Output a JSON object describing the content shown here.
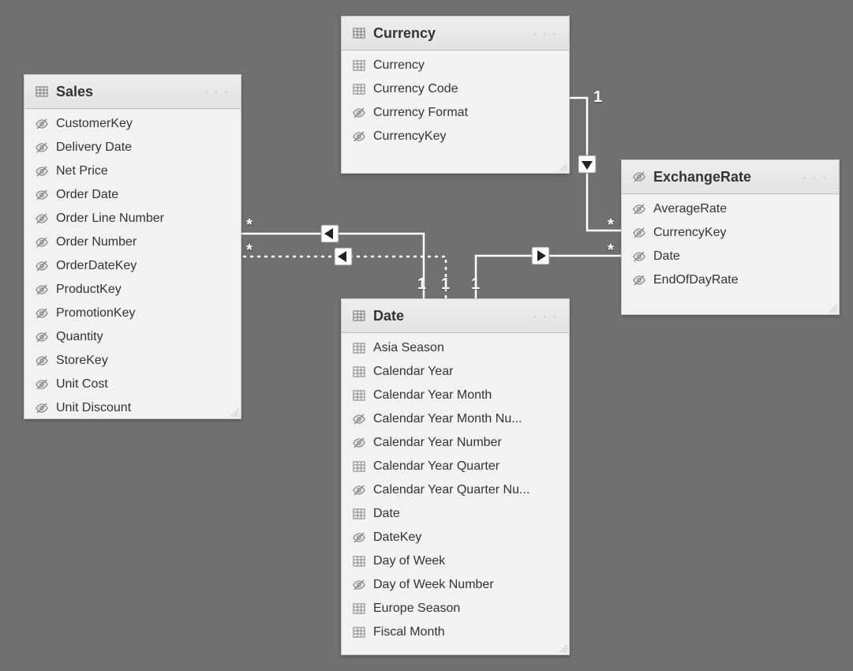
{
  "tables": {
    "sales": {
      "title": "Sales",
      "fields": [
        {
          "label": "CustomerKey",
          "hidden": true
        },
        {
          "label": "Delivery Date",
          "hidden": true
        },
        {
          "label": "Net Price",
          "hidden": true
        },
        {
          "label": "Order Date",
          "hidden": true
        },
        {
          "label": "Order Line Number",
          "hidden": true
        },
        {
          "label": "Order Number",
          "hidden": true
        },
        {
          "label": "OrderDateKey",
          "hidden": true
        },
        {
          "label": "ProductKey",
          "hidden": true
        },
        {
          "label": "PromotionKey",
          "hidden": true
        },
        {
          "label": "Quantity",
          "hidden": true
        },
        {
          "label": "StoreKey",
          "hidden": true
        },
        {
          "label": "Unit Cost",
          "hidden": true
        },
        {
          "label": "Unit Discount",
          "hidden": true
        }
      ]
    },
    "currency": {
      "title": "Currency",
      "fields": [
        {
          "label": "Currency",
          "hidden": false
        },
        {
          "label": "Currency Code",
          "hidden": false
        },
        {
          "label": "Currency Format",
          "hidden": true
        },
        {
          "label": "CurrencyKey",
          "hidden": true
        }
      ]
    },
    "date": {
      "title": "Date",
      "fields": [
        {
          "label": "Asia Season",
          "hidden": false
        },
        {
          "label": "Calendar Year",
          "hidden": false
        },
        {
          "label": "Calendar Year Month",
          "hidden": false
        },
        {
          "label": "Calendar Year Month Nu...",
          "hidden": true
        },
        {
          "label": "Calendar Year Number",
          "hidden": true
        },
        {
          "label": "Calendar Year Quarter",
          "hidden": false
        },
        {
          "label": "Calendar Year Quarter Nu...",
          "hidden": true
        },
        {
          "label": "Date",
          "hidden": false
        },
        {
          "label": "DateKey",
          "hidden": true
        },
        {
          "label": "Day of Week",
          "hidden": false
        },
        {
          "label": "Day of Week Number",
          "hidden": true
        },
        {
          "label": "Europe Season",
          "hidden": false
        },
        {
          "label": "Fiscal Month",
          "hidden": false
        }
      ]
    },
    "exchangerate": {
      "title": "ExchangeRate",
      "headerHidden": true,
      "fields": [
        {
          "label": "AverageRate",
          "hidden": true
        },
        {
          "label": "CurrencyKey",
          "hidden": true
        },
        {
          "label": "Date",
          "hidden": true
        },
        {
          "label": "EndOfDayRate",
          "hidden": true
        }
      ]
    }
  },
  "relationships": [
    {
      "from": "Date",
      "to": "Sales",
      "fromCard": "1",
      "toCard": "*",
      "active": true,
      "direction": "to"
    },
    {
      "from": "Date",
      "to": "Sales",
      "fromCard": "1",
      "toCard": "*",
      "active": false,
      "direction": "to"
    },
    {
      "from": "Date",
      "to": "ExchangeRate",
      "fromCard": "1",
      "toCard": "*",
      "active": true,
      "direction": "from"
    },
    {
      "from": "Currency",
      "to": "ExchangeRate",
      "fromCard": "1",
      "toCard": "*",
      "active": true,
      "direction": "from"
    }
  ],
  "moreGlyph": "· · ·"
}
